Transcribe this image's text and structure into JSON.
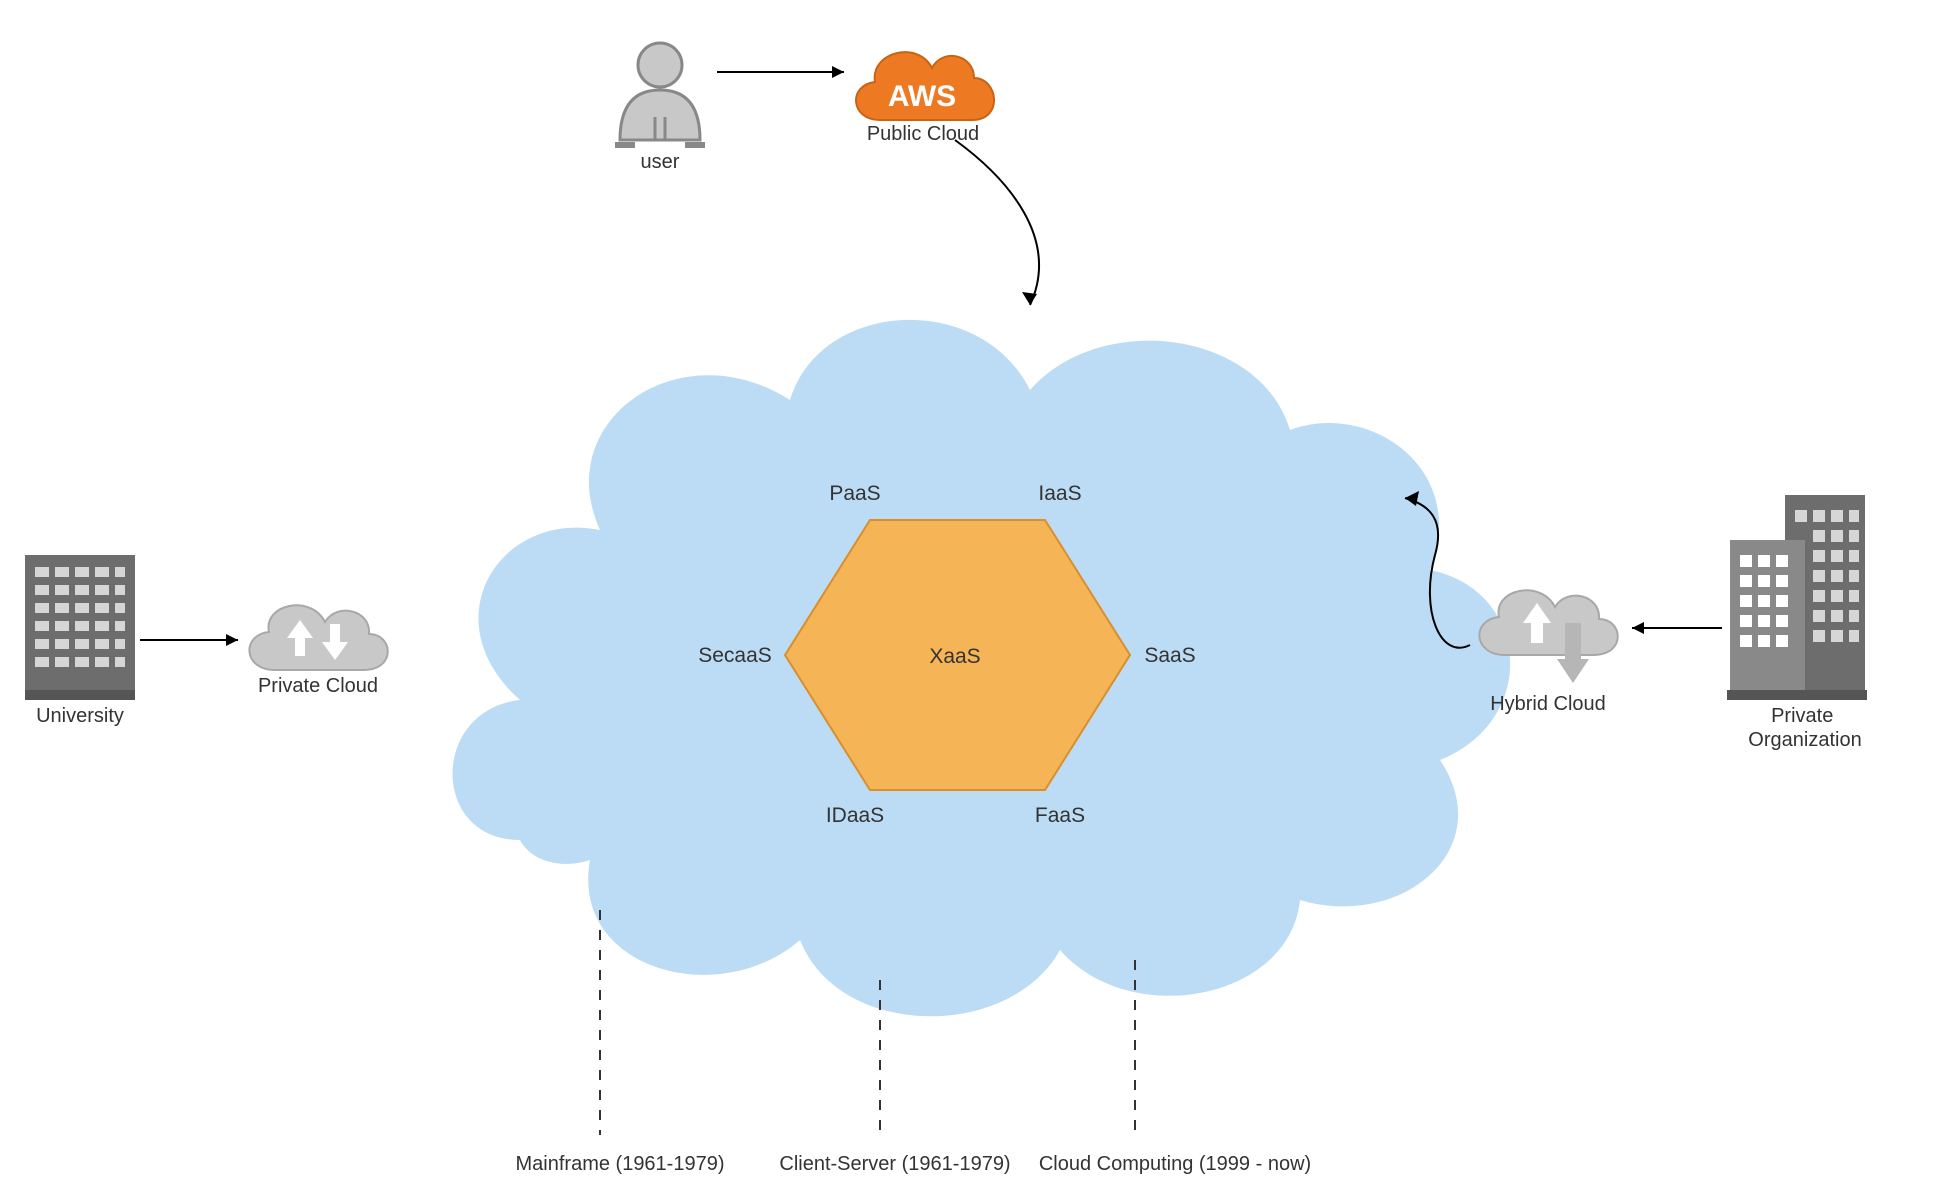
{
  "nodes": {
    "user": {
      "label": "user"
    },
    "aws": {
      "label": "AWS",
      "caption": "Public Cloud"
    },
    "university": {
      "label": "University"
    },
    "privateCloud": {
      "label": "Private Cloud"
    },
    "hybridCloud": {
      "label": "Hybrid Cloud"
    },
    "privateOrg": {
      "label": "Private Organization"
    },
    "hexagon": {
      "label": "XaaS"
    }
  },
  "services": {
    "top_left": "PaaS",
    "top_right": "IaaS",
    "left": "SecaaS",
    "right": "SaaS",
    "bottom_left": "IDaaS",
    "bottom_right": "FaaS"
  },
  "timeline": {
    "mainframe": "Mainframe (1961-1979)",
    "clientServer": "Client-Server (1961-1979)",
    "cloud": "Cloud Computing (1999 - now)"
  },
  "colors": {
    "cloud_fill": "#bbdcf4",
    "hex_fill": "#f5b456",
    "hex_stroke": "#d98f2b",
    "aws_orange": "#ed7a23",
    "grey_icon": "#888888",
    "grey_dark": "#6d6d6d",
    "grey_light": "#c8c8c8"
  }
}
